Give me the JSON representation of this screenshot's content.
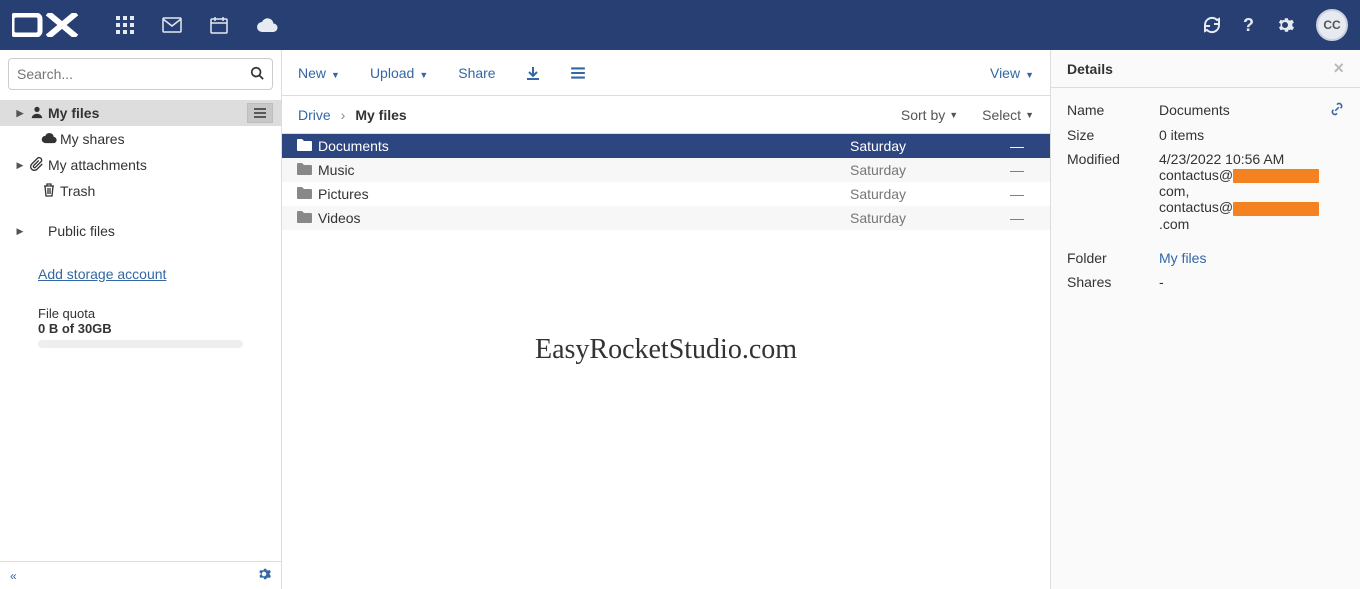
{
  "topbar": {
    "avatar_initials": "CC"
  },
  "sidebar": {
    "search_placeholder": "Search...",
    "items": {
      "my_files": "My files",
      "my_shares": "My shares",
      "my_attachments": "My attachments",
      "trash": "Trash",
      "public_files": "Public files"
    },
    "add_account": "Add storage account",
    "quota_label": "File quota",
    "quota_value": "0 B of 30GB"
  },
  "toolbar": {
    "new": "New",
    "upload": "Upload",
    "share": "Share",
    "view": "View"
  },
  "breadcrumb": {
    "root": "Drive",
    "current": "My files",
    "sort": "Sort by",
    "select": "Select"
  },
  "files": [
    {
      "name": "Documents",
      "date": "Saturday",
      "size": "—",
      "selected": true
    },
    {
      "name": "Music",
      "date": "Saturday",
      "size": "—"
    },
    {
      "name": "Pictures",
      "date": "Saturday",
      "size": "—"
    },
    {
      "name": "Videos",
      "date": "Saturday",
      "size": "—"
    }
  ],
  "watermark": "EasyRocketStudio.com",
  "details": {
    "title": "Details",
    "name_label": "Name",
    "name_value": "Documents",
    "size_label": "Size",
    "size_value": "0 items",
    "modified_label": "Modified",
    "modified_value": "4/23/2022 10:56 AM",
    "modified_by_prefix": "contactus@",
    "modified_by_suffix1": "com,",
    "modified_by_suffix2": ".com",
    "folder_label": "Folder",
    "folder_value": "My files",
    "shares_label": "Shares",
    "shares_value": "-"
  }
}
